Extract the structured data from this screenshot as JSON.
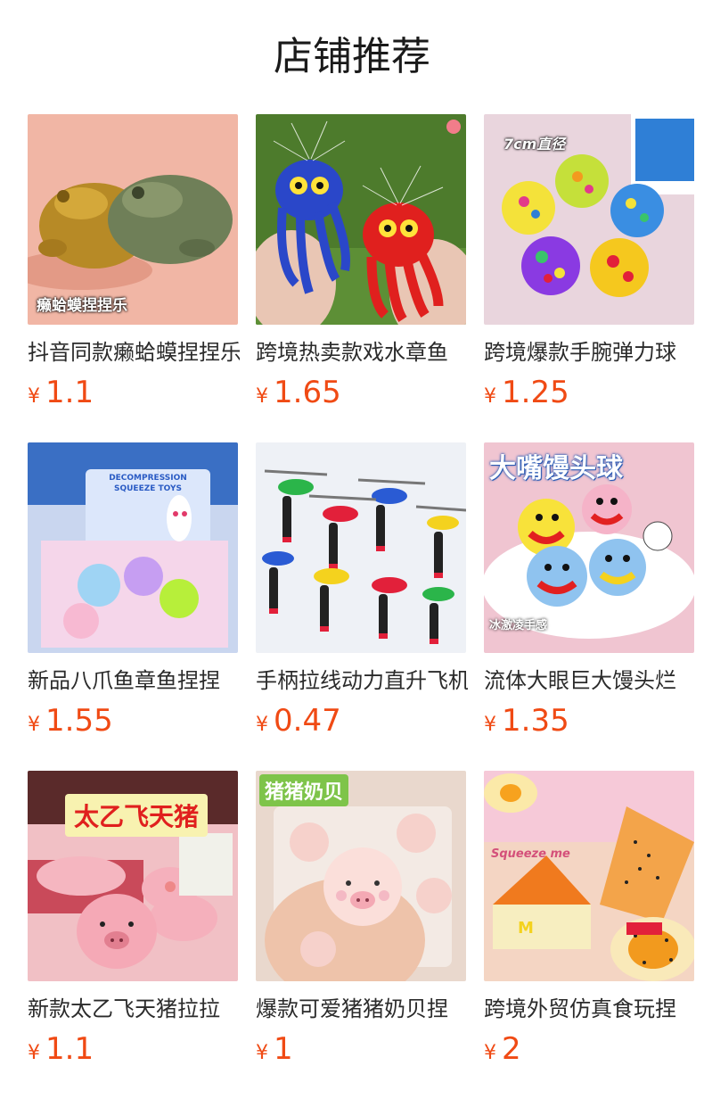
{
  "page": {
    "title": "店铺推荐"
  },
  "products": [
    {
      "name": "抖音同款癞蛤蟆捏捏乐",
      "currency": "¥",
      "price": "1.1",
      "image_caption": "癞蛤蟆捏捏乐",
      "image_icon": "toad-toy-icon",
      "bg": "#f3b7a6"
    },
    {
      "name": "跨境热卖款戏水章鱼",
      "currency": "¥",
      "price": "1.65",
      "image_caption": "",
      "image_icon": "octopus-water-toy-icon",
      "bg": "#4f7f2e"
    },
    {
      "name": "跨境爆款手腕弹力球",
      "currency": "¥",
      "price": "1.25",
      "image_caption": "7cm直径",
      "image_icon": "bounce-ball-icon",
      "bg": "#ead7df"
    },
    {
      "name": "新品八爪鱼章鱼捏捏",
      "currency": "¥",
      "price": "1.55",
      "image_caption": "DECOMPRESSION SQUEEZE TOYS",
      "image_icon": "octopus-squeeze-box-icon",
      "bg": "#c9d7f0"
    },
    {
      "name": "手柄拉线动力直升飞机",
      "currency": "¥",
      "price": "0.47",
      "image_caption": "",
      "image_icon": "helicopter-toy-icon",
      "bg": "#eef1f6"
    },
    {
      "name": "流体大眼巨大馒头烂",
      "currency": "¥",
      "price": "1.35",
      "image_caption": "大嘴馒头球",
      "image_sub": "冰激凌手感",
      "image_icon": "mantou-ball-icon",
      "bg": "#f0c6d2"
    },
    {
      "name": "新款太乙飞天猪拉拉",
      "currency": "¥",
      "price": "1.1",
      "image_caption": "太乙飞天猪",
      "image_icon": "flying-pig-toy-icon",
      "bg": "#f2c2c6"
    },
    {
      "name": "爆款可爱猪猪奶贝捏",
      "currency": "¥",
      "price": "1",
      "image_caption": "猪猪奶贝",
      "image_icon": "pig-milk-squeeze-icon",
      "bg": "#ead9cf"
    },
    {
      "name": "跨境外贸仿真食玩捏",
      "currency": "¥",
      "price": "2",
      "image_caption": "Squeeze me",
      "image_icon": "fake-food-squeeze-icon",
      "bg": "#f5d6c4"
    }
  ]
}
